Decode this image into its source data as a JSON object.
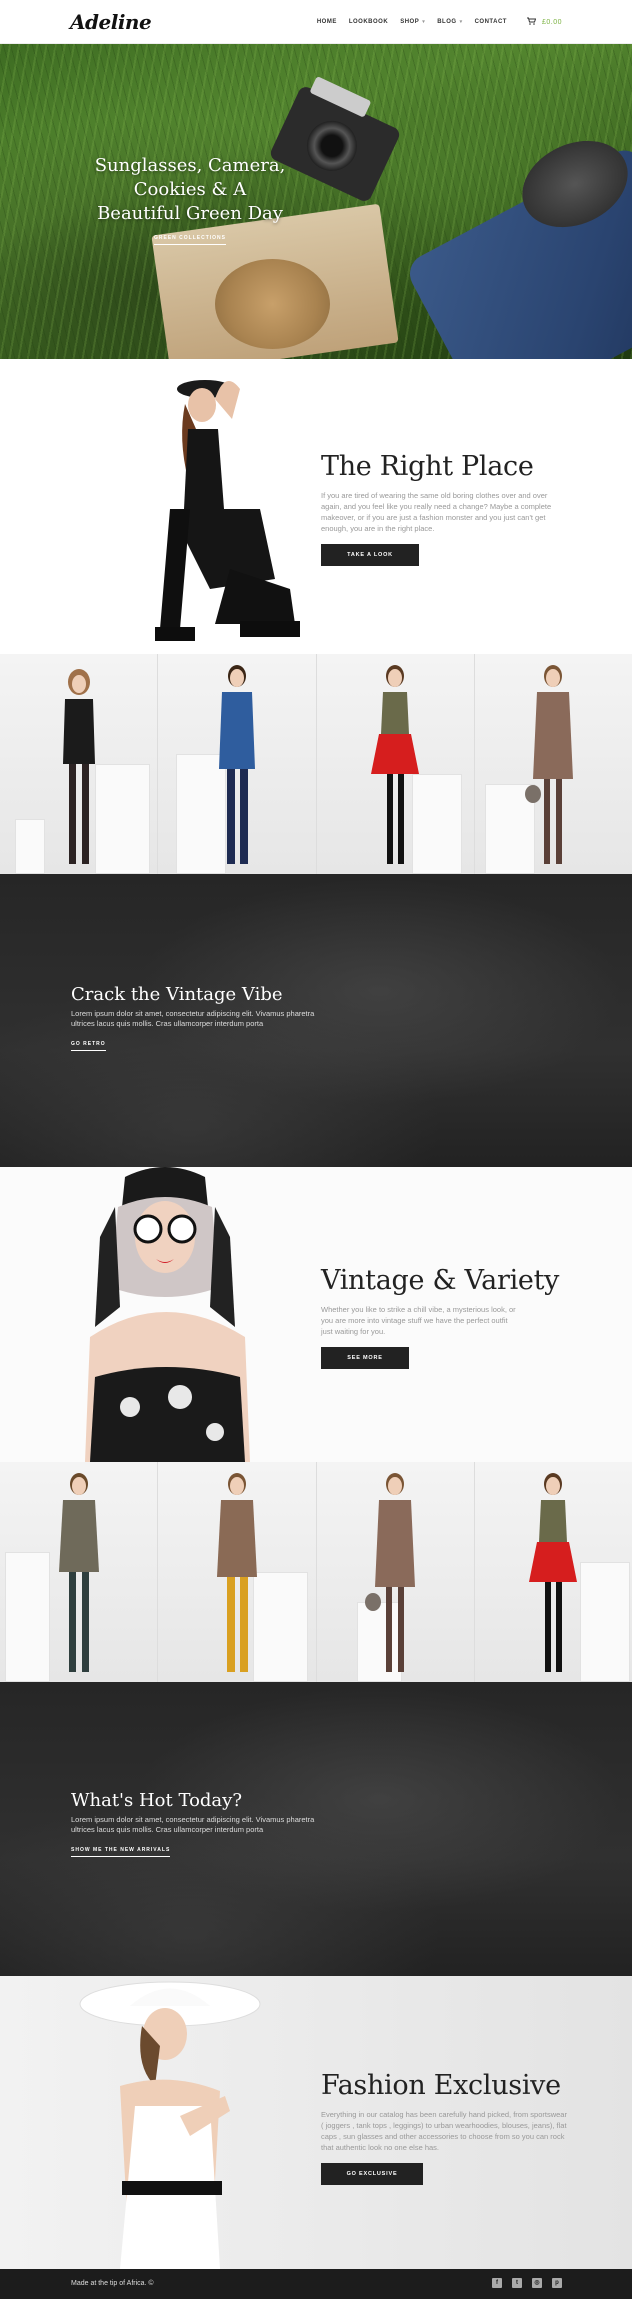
{
  "header": {
    "logo": "Adeline",
    "nav": [
      {
        "label": "HOME"
      },
      {
        "label": "LOOKBOOK"
      },
      {
        "label": "SHOP"
      },
      {
        "label": "BLOG"
      },
      {
        "label": "CONTACT"
      }
    ],
    "cart_total": "£0.00"
  },
  "hero": {
    "title": "Sunglasses, Camera, Cookies & A Beautiful Green Day",
    "link": "GREEN COLLECTIONS"
  },
  "features": [
    {
      "title": "The Right Place",
      "body": "If you are tired of wearing the same old boring clothes over and over again, and you feel like you really need a change? Maybe a complete makeover, or if you are just a fashion monster and you just can't get enough, you are in the right place.",
      "button": "TAKE A LOOK"
    },
    {
      "title": "Vintage & Variety",
      "body": "Whether you like to strike a chill vibe, a mysterious look, or you are more into vintage stuff we have the perfect outfit just waiting for you.",
      "button": "SEE MORE"
    },
    {
      "title": "Fashion Exclusive",
      "body": "Everything in our catalog has been carefully hand picked, from sportswear ( joggers , tank tops , leggings) to urban wearhoodies, blouses, jeans), flat caps , sun glasses and other accessories to choose from so you can rock that authentic look no one else has.",
      "button": "GO EXCLUSIVE"
    }
  ],
  "banners": [
    {
      "title": "Crack the Vintage Vibe",
      "body": "Lorem ipsum dolor sit amet, consectetur adipiscing elit. Vivamus pharetra ultrices lacus quis mollis. Cras ullamcorper interdum porta",
      "link": "GO RETRO"
    },
    {
      "title": "What's Hot Today?",
      "body": "Lorem ipsum dolor sit amet, consectetur adipiscing elit. Vivamus pharetra ultrices lacus quis mollis. Cras ullamcorper interdum porta",
      "link": "SHOW ME THE NEW ARRIVALS"
    }
  ],
  "footer": {
    "made_text": "Made at the tip of Africa. ©",
    "social_icons": [
      "facebook-icon",
      "twitter-icon",
      "instagram-icon",
      "pinterest-icon"
    ]
  },
  "colors": {
    "accent_green": "#7bb241",
    "dark": "#222222",
    "banner_bg": "#2b2b2b",
    "footer_bg": "#1c1c1c"
  }
}
